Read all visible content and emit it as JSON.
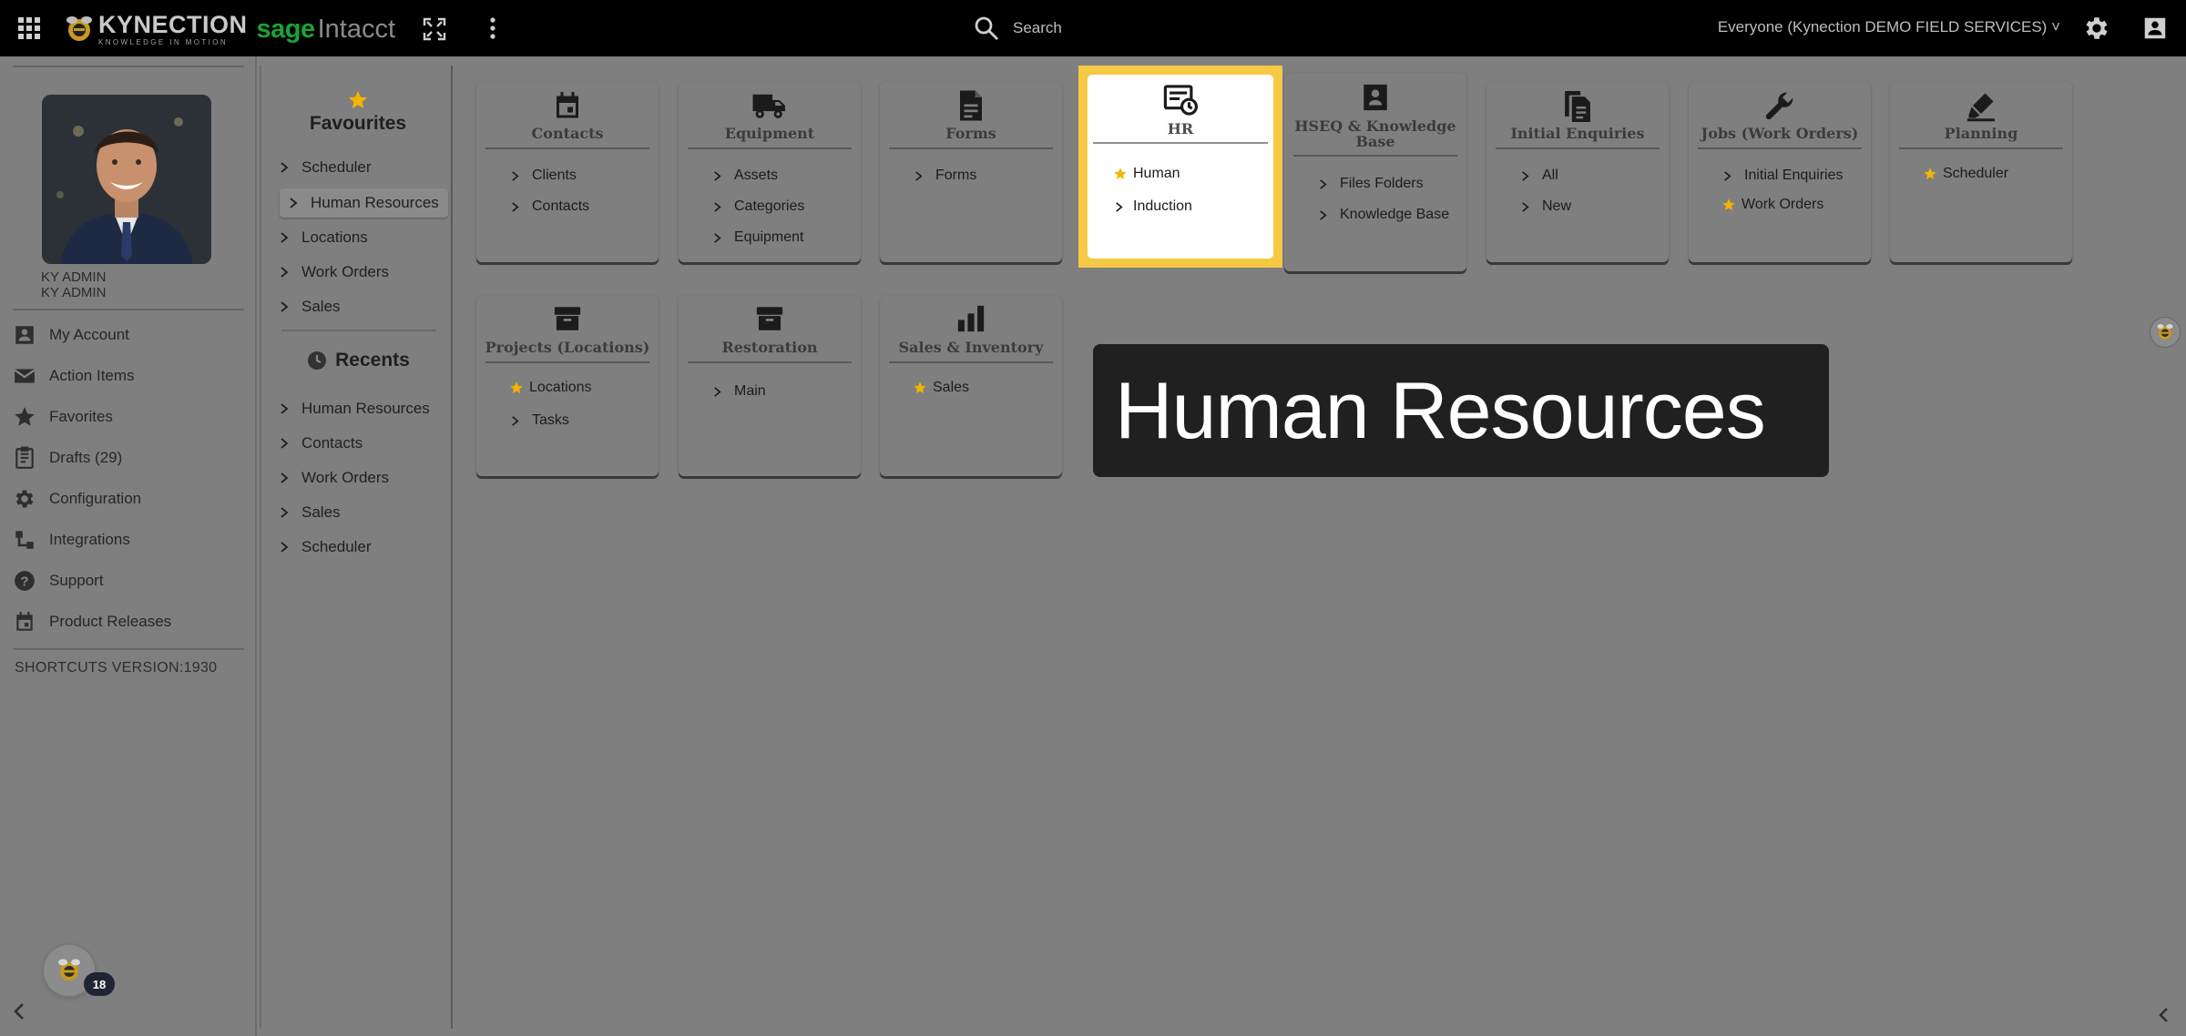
{
  "topbar": {
    "brand_name": "KYNECTION",
    "brand_tagline": "KNOWLEDGE IN MOTION",
    "product_sage": "sage",
    "product_intacct": "Intacct",
    "search_placeholder": "Search",
    "company_selector": "Everyone (Kynection DEMO FIELD SERVICES) ˅"
  },
  "sidebar": {
    "user_name_1": "KY ADMIN",
    "user_name_2": "KY ADMIN",
    "items": [
      {
        "label": "My Account",
        "icon": "account-box-icon"
      },
      {
        "label": "Action Items",
        "icon": "mail-icon"
      },
      {
        "label": "Favorites",
        "icon": "star-icon"
      },
      {
        "label": "Drafts (29)",
        "icon": "drafts-icon"
      },
      {
        "label": "Configuration",
        "icon": "gear-icon"
      },
      {
        "label": "Integrations",
        "icon": "integration-icon"
      },
      {
        "label": "Support",
        "icon": "help-icon"
      },
      {
        "label": "Product Releases",
        "icon": "calendar-icon"
      }
    ],
    "shortcuts_version": "SHORTCUTS VERSION:1930",
    "notification_count": "18"
  },
  "favourites": {
    "title": "Favourites",
    "items": [
      "Scheduler",
      "Human Resources",
      "Locations",
      "Work Orders",
      "Sales"
    ],
    "active_index": 1
  },
  "recents": {
    "title": "Recents",
    "items": [
      "Human Resources",
      "Contacts",
      "Work Orders",
      "Sales",
      "Scheduler"
    ]
  },
  "tiles": {
    "contacts": {
      "title": "Contacts",
      "items": [
        "Clients",
        "Contacts"
      ]
    },
    "equipment": {
      "title": "Equipment",
      "items": [
        "Assets",
        "Categories",
        "Equipment"
      ]
    },
    "forms": {
      "title": "Forms",
      "items": [
        "Forms"
      ]
    },
    "hr": {
      "title": "HR",
      "items": [
        "Human",
        "Induction"
      ]
    },
    "hseq": {
      "title_1": "HSEQ & Knowledge",
      "title_2": "Base",
      "items": [
        "Files Folders",
        "Knowledge Base"
      ]
    },
    "initial_enquiries": {
      "title": "Initial Enquiries",
      "items": [
        "All",
        "New"
      ]
    },
    "jobs": {
      "title": "Jobs (Work Orders)",
      "items": [
        "Initial Enquiries",
        "Work Orders"
      ]
    },
    "planning": {
      "title": "Planning",
      "items": [
        "Scheduler"
      ]
    },
    "projects": {
      "title": "Projects (Locations)",
      "items": [
        "Locations",
        "Tasks"
      ]
    },
    "restoration": {
      "title": "Restoration",
      "items": [
        "Main"
      ]
    },
    "sales_inventory": {
      "title": "Sales & Inventory",
      "items": [
        "Sales"
      ]
    }
  },
  "banner": {
    "text": "Human Resources"
  },
  "colors": {
    "highlight": "#f6c945",
    "star": "#f5b400",
    "sage_green": "#1aa335"
  }
}
